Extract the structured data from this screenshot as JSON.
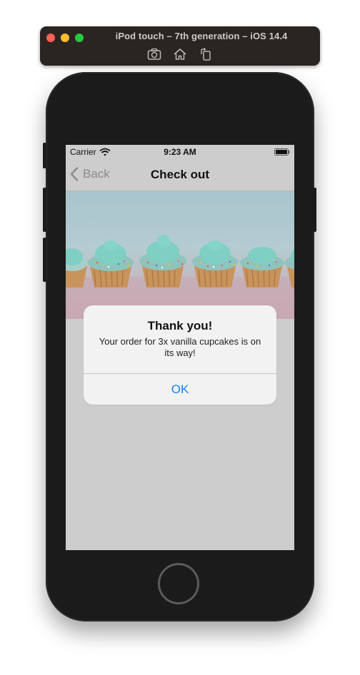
{
  "simulator": {
    "title": "iPod touch – 7th generation – iOS 14.4",
    "tools": [
      "camera-icon",
      "home-icon",
      "rotate-icon"
    ]
  },
  "status_bar": {
    "carrier": "Carrier",
    "time": "9:23 AM"
  },
  "nav": {
    "back_label": "Back",
    "title": "Check out"
  },
  "alert": {
    "title": "Thank you!",
    "message": "Your order for 3x vanilla cupcakes is on its way!",
    "ok_label": "OK"
  },
  "colors": {
    "accent": "#1a7ff0",
    "screen_background": "#cdcdcd",
    "frosting": "#7fcfc3"
  }
}
